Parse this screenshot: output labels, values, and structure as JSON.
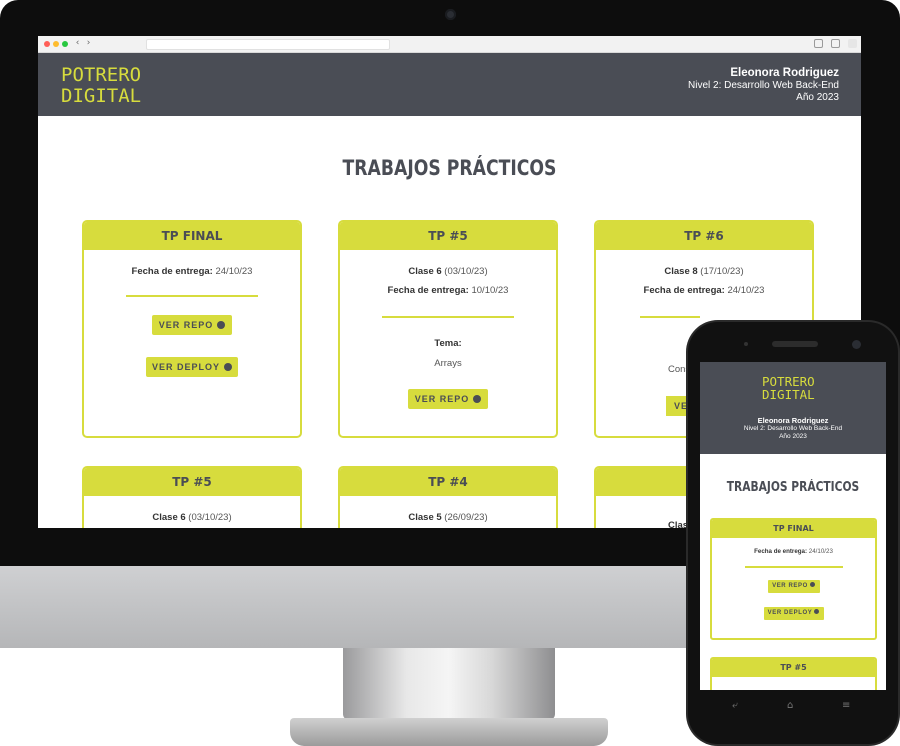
{
  "site": {
    "logo_line1": "POTRERO",
    "logo_line2": "DIGITAL",
    "author": "Eleonora Rodriguez",
    "course": "Nivel 2: Desarrollo Web Back-End",
    "year": "Año 2023",
    "page_title": "TRABAJOS PRÁCTICOS"
  },
  "labels": {
    "fecha_entrega": "Fecha de entrega:",
    "tema": "Tema:",
    "ver_repo": "VER REPO",
    "ver_deploy": "VER DEPLOY"
  },
  "cards": [
    {
      "title": "TP FINAL",
      "fecha": "24/10/23"
    },
    {
      "title": "TP #5",
      "clase_label": "Clase 6",
      "clase_date": "(03/10/23)",
      "fecha": "10/10/23",
      "tema_value": "Arrays"
    },
    {
      "title": "TP #6",
      "clase_label": "Clase 8",
      "clase_date": "(17/10/23)",
      "fecha": "24/10/23",
      "tema_value_partial": "Cons",
      "repo_partial": "VE"
    },
    {
      "title": "TP #5",
      "clase_label": "Clase 6",
      "clase_date": "(03/10/23)"
    },
    {
      "title": "TP #4",
      "clase_label": "Clase 5",
      "clase_date": "(26/09/23)"
    },
    {
      "clase_partial": "Clas"
    }
  ],
  "phone": {
    "cards": [
      {
        "title": "TP FINAL",
        "fecha": "24/10/23"
      },
      {
        "title": "TP #5"
      }
    ]
  },
  "colors": {
    "accent": "#d7dc3d",
    "header_bg": "#4a4d55"
  },
  "icons": [
    "github-icon",
    "back-arrow-icon",
    "forward-arrow-icon",
    "share-icon",
    "tabs-icon",
    "home-icon",
    "menu-icon"
  ]
}
